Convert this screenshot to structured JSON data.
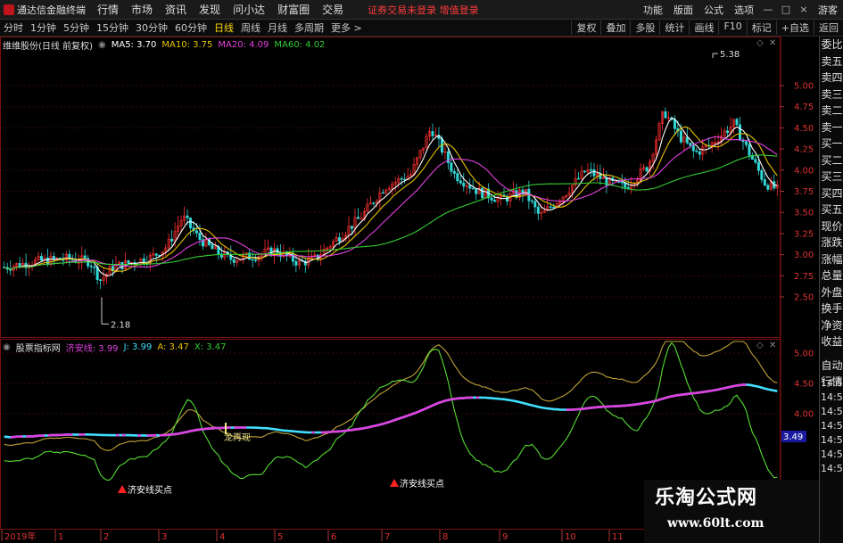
{
  "app": {
    "name": "通达信金融终端"
  },
  "menu": [
    "行情",
    "市场",
    "资讯",
    "发现",
    "问小达",
    "财富圈",
    "交易"
  ],
  "warning": "证券交易未登录 增值登录",
  "menu_right": [
    "功能",
    "版面",
    "公式",
    "选项"
  ],
  "guest": "游客",
  "window_controls": [
    "—",
    "□",
    "×"
  ],
  "periods": [
    "分时",
    "1分钟",
    "5分钟",
    "15分钟",
    "30分钟",
    "60分钟",
    "日线",
    "周线",
    "月线",
    "多周期",
    "更多 >"
  ],
  "active_period": "日线",
  "toolbar_right": [
    "复权",
    "叠加",
    "多股",
    "统计",
    "画线",
    "F10",
    "标记",
    "+自选",
    "返回"
  ],
  "price_legend": {
    "title": "维维股份(日线 前复权)",
    "ma": [
      {
        "label": "MA5: 3.70",
        "color": "#ffffff"
      },
      {
        "label": "MA10: 3.75",
        "color": "#e6c200"
      },
      {
        "label": "MA20: 4.09",
        "color": "#e040e0"
      },
      {
        "label": "MA60: 4.02",
        "color": "#33cc33"
      }
    ]
  },
  "price_axis": [
    "5.00",
    "4.75",
    "4.50",
    "4.25",
    "4.00",
    "3.75",
    "3.50",
    "3.25",
    "3.00",
    "2.75",
    "2.50"
  ],
  "price_annotations": {
    "high": "5.38",
    "low": "2.18"
  },
  "indicator_legend": {
    "title": "股票指标网",
    "items": [
      {
        "label": "济安线: 3.99",
        "color": "#e040e0"
      },
      {
        "label": "J: 3.99",
        "color": "#40e0ff"
      },
      {
        "label": "A: 3.47",
        "color": "#e6c200"
      },
      {
        "label": "X: 3.47",
        "color": "#33cc33"
      }
    ]
  },
  "indicator_axis": [
    "5.00",
    "4.50",
    "4.00"
  ],
  "indicator_value_box": "3.49",
  "signal_labels": [
    "济安线买点",
    "济安线买点"
  ],
  "text_annotation": "龙再现",
  "x_axis": [
    "2019年",
    "1",
    "2",
    "3",
    "4",
    "5",
    "6",
    "7",
    "8",
    "9",
    "10",
    "11"
  ],
  "sidebar_top": [
    "委比",
    "卖五",
    "卖四",
    "卖三",
    "卖二",
    "卖一",
    "买一",
    "买二",
    "买三",
    "买四",
    "买五",
    "现价",
    "涨跌",
    "涨幅",
    "总量",
    "外盘",
    "换手",
    "净资",
    "收益"
  ],
  "sidebar_bottom": [
    "自动",
    "行情"
  ],
  "time_stamps": [
    "14:5",
    "14:5",
    "14:5",
    "14:5",
    "14:5",
    "14:5",
    "14:5"
  ],
  "watermark": {
    "title": "乐淘公式网",
    "url": "www.60lt.com"
  }
}
